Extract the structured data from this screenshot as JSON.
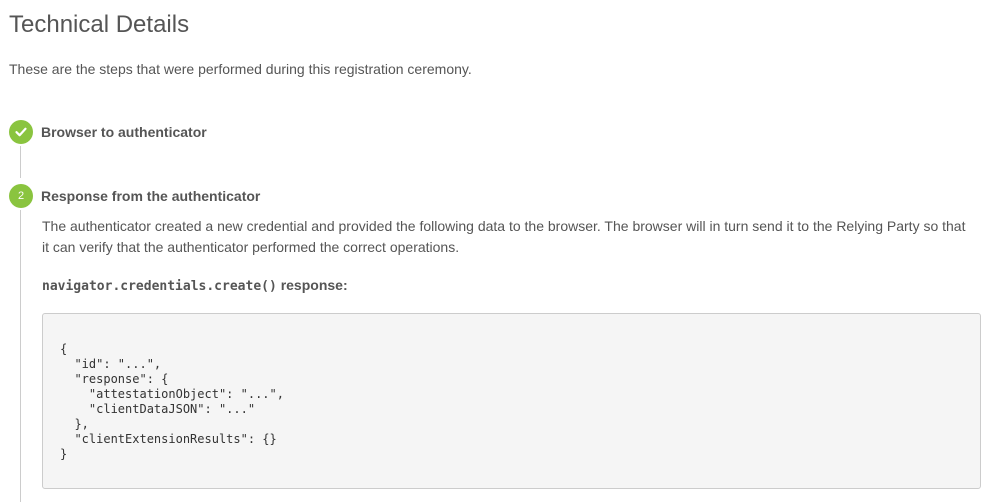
{
  "page": {
    "title": "Technical Details",
    "intro": "These are the steps that were performed during this registration ceremony."
  },
  "colors": {
    "accent": "#8ac43f",
    "text": "#555555",
    "code_background": "#f5f5f5"
  },
  "steps": [
    {
      "status": "complete",
      "icon": "checkmark-icon",
      "title": "Browser to authenticator"
    },
    {
      "status": "current",
      "number": "2",
      "title": "Response from the authenticator",
      "description": "The authenticator created a new credential and provided the following data to the browser. The browser will in turn send it to the Relying Party so that it can verify that the authenticator performed the correct operations.",
      "response_label_code": "navigator.credentials.create()",
      "response_label_text": " response:",
      "code": "{\n  \"id\": \"...\",\n  \"response\": {\n    \"attestationObject\": \"...\",\n    \"clientDataJSON\": \"...\"\n  },\n  \"clientExtensionResults\": {}\n}"
    }
  ]
}
